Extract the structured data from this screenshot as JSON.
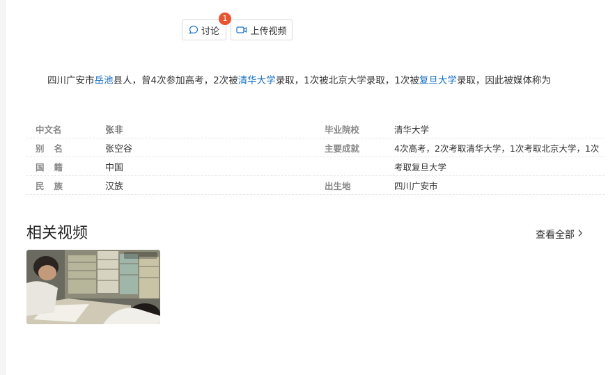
{
  "toolbar": {
    "discuss_label": "讨论",
    "discuss_count": "1",
    "upload_label": "上传视频"
  },
  "summary": {
    "part1": "四川广安市",
    "link1": "岳池",
    "part2": "县人，曾4次参加高考，2次被",
    "link2": "清华大学",
    "part3": "录取，1次被北京大学录取，1次被",
    "link3": "复旦大学",
    "part4": "录取，因此被媒体称为"
  },
  "info": {
    "rows": [
      {
        "k1": "中文名",
        "v1": "张非",
        "k2": "毕业院校",
        "v2": "清华大学"
      },
      {
        "k1": "别名",
        "v1": "张空谷",
        "k2": "主要成就",
        "v2": "4次高考，2次考取清华大学，1次考取北京大学，1次"
      },
      {
        "k1": "国籍",
        "v1": "中国",
        "k2": "",
        "v2": "考取复旦大学"
      },
      {
        "k1": "民族",
        "v1": "汉族",
        "k2": "出生地",
        "v2": "四川广安市"
      }
    ]
  },
  "related": {
    "title": "相关视频",
    "view_all": "查看全部"
  },
  "colors": {
    "link": "#136ec2",
    "badge": "#e8542f"
  }
}
